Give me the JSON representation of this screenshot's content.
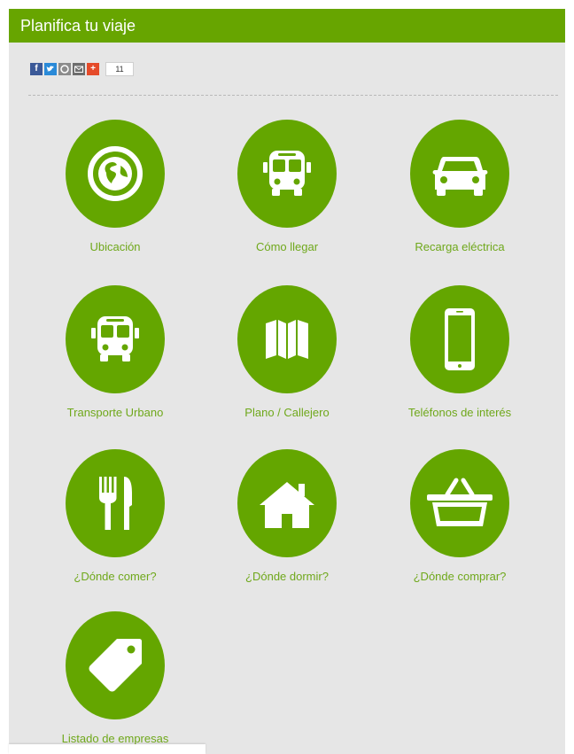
{
  "header": {
    "title": "Planifica tu viaje"
  },
  "share": {
    "count": "11",
    "buttons": [
      {
        "name": "facebook",
        "glyph": "f",
        "color": "#3b5998"
      },
      {
        "name": "twitter",
        "glyph": "t",
        "color": "#2a8ad8"
      },
      {
        "name": "pinterest",
        "glyph": "",
        "color": "#8c8c8c"
      },
      {
        "name": "email",
        "glyph": "",
        "color": "#6d6d6d"
      },
      {
        "name": "plus",
        "glyph": "+",
        "color": "#e54b2a"
      }
    ]
  },
  "items": [
    {
      "label": "Ubicación",
      "icon": "globe-icon"
    },
    {
      "label": "Cómo llegar",
      "icon": "bus-icon"
    },
    {
      "label": "Recarga eléctrica",
      "icon": "car-icon"
    },
    {
      "label": "Transporte Urbano",
      "icon": "bus-icon"
    },
    {
      "label": "Plano / Callejero",
      "icon": "map-icon"
    },
    {
      "label": "Teléfonos de interés",
      "icon": "phone-icon"
    },
    {
      "label": "¿Dónde comer?",
      "icon": "cutlery-icon"
    },
    {
      "label": "¿Dónde dormir?",
      "icon": "house-icon"
    },
    {
      "label": "¿Dónde comprar?",
      "icon": "basket-icon"
    },
    {
      "label": "Listado de empresas",
      "icon": "tag-icon"
    }
  ],
  "colors": {
    "accent": "#67a500",
    "circle": "#64a600",
    "label": "#6fa81b",
    "background": "#e6e6e6"
  }
}
